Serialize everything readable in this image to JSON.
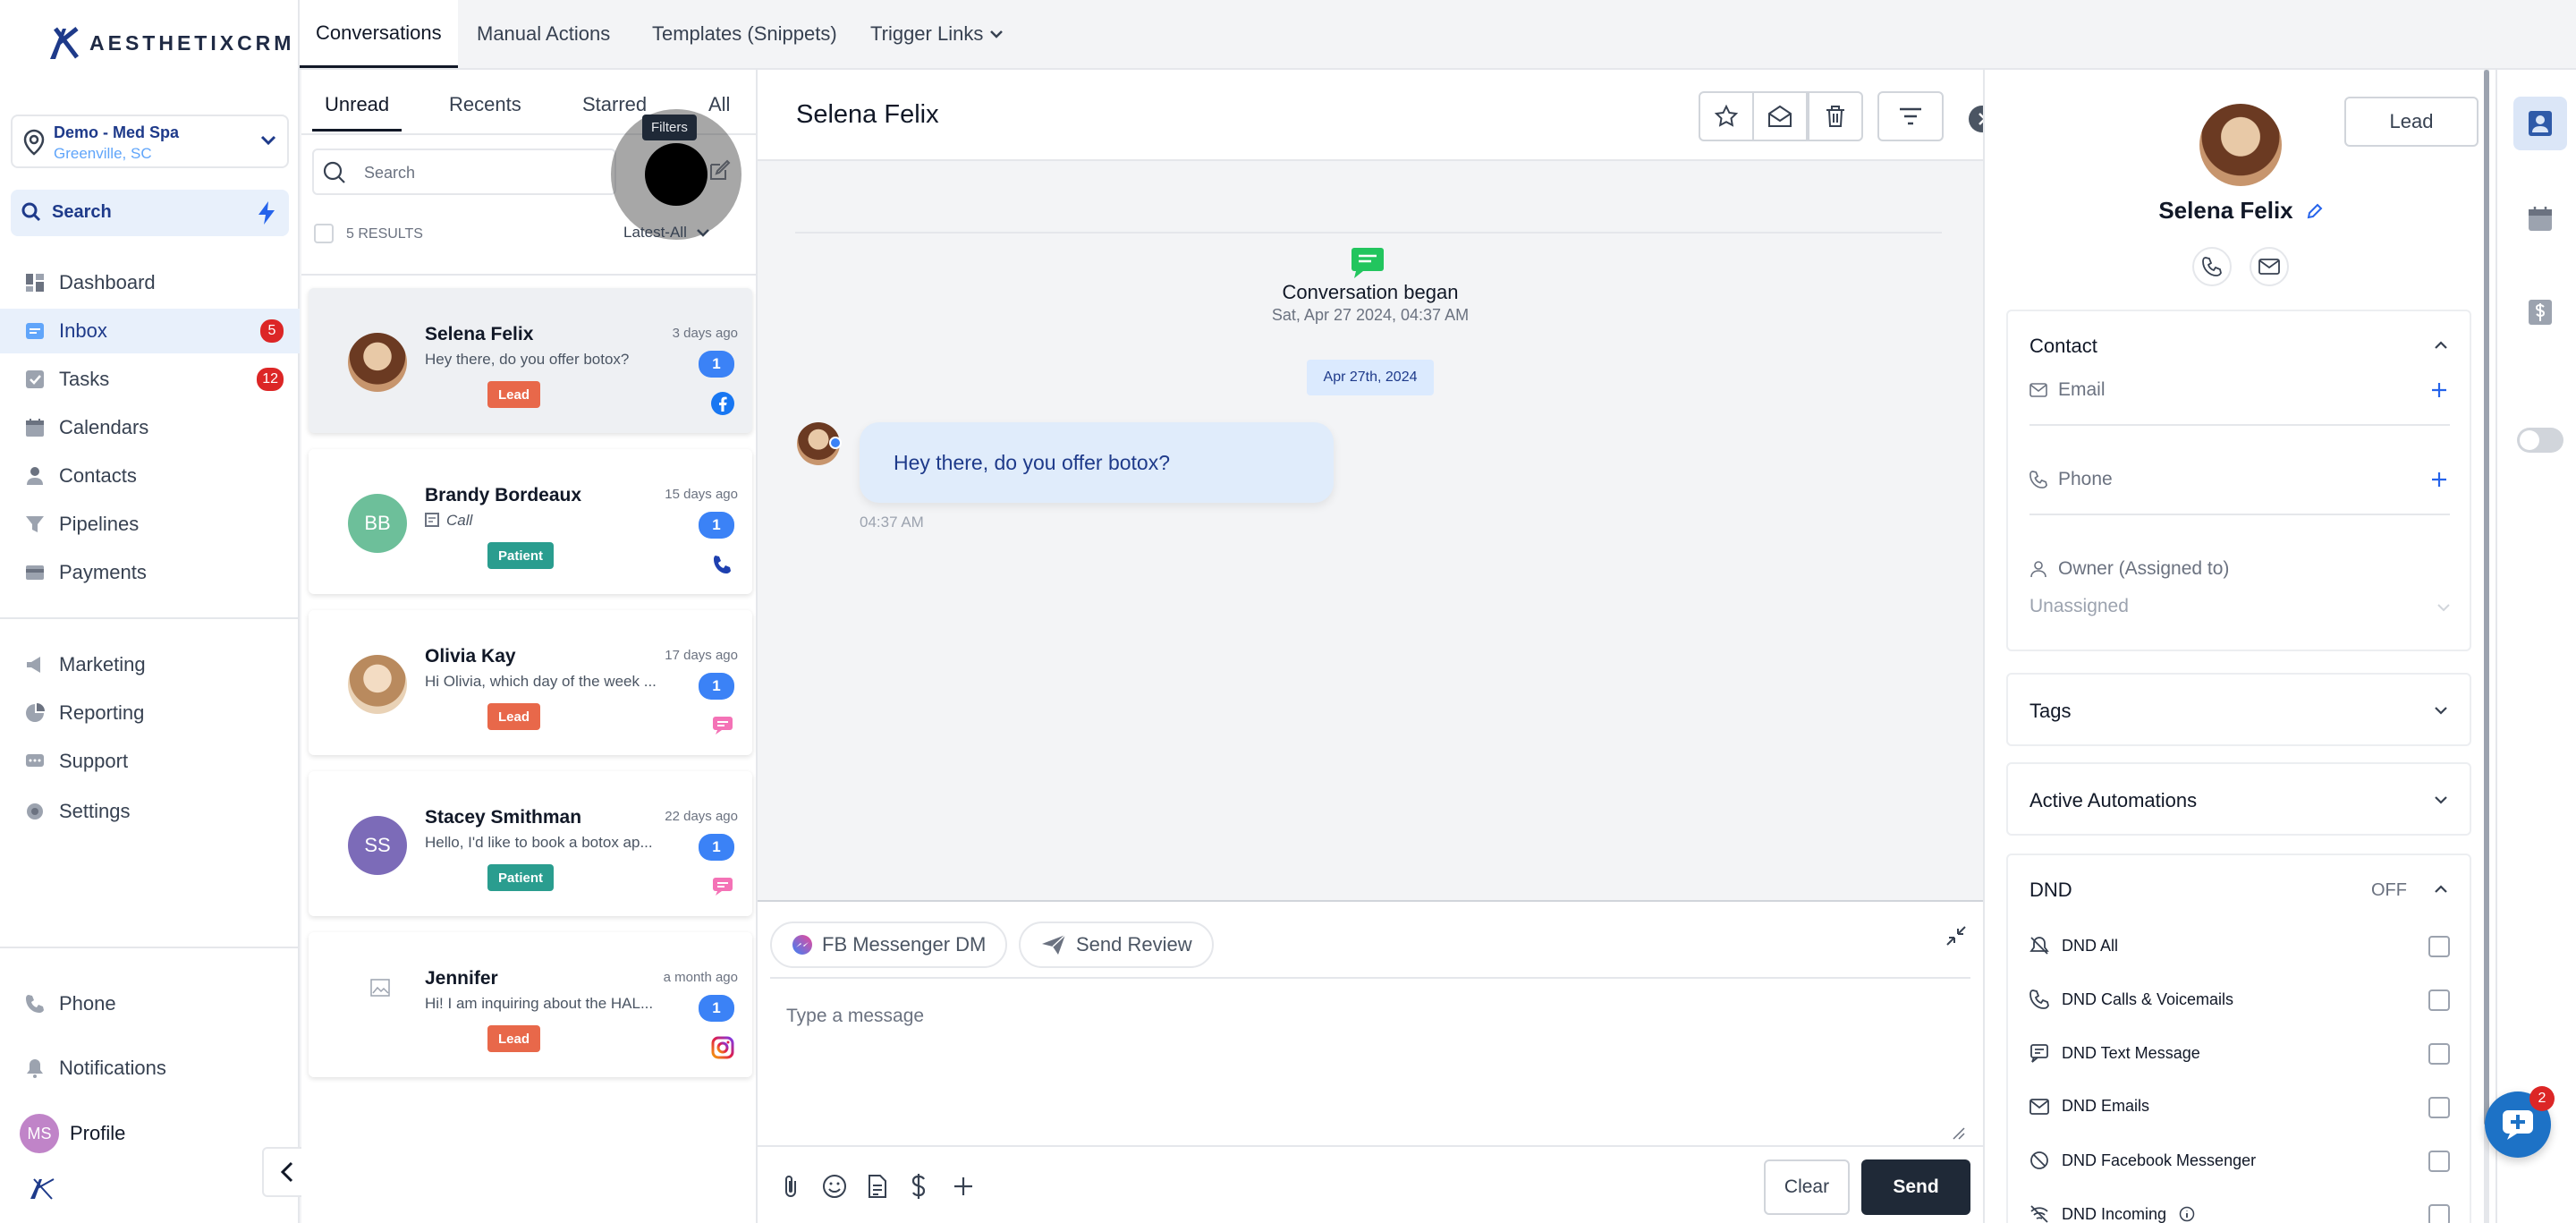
{
  "brand": {
    "name": "AESTHETIXCRM",
    "accent": "#1e3a8a"
  },
  "location": {
    "name": "Demo - Med Spa",
    "city": "Greenville, SC"
  },
  "sidebar_search": {
    "label": "Search"
  },
  "nav": [
    {
      "label": "Dashboard",
      "icon": "dashboard-icon"
    },
    {
      "label": "Inbox",
      "icon": "inbox-icon",
      "badge": "5"
    },
    {
      "label": "Tasks",
      "icon": "tasks-icon",
      "badge": "12"
    },
    {
      "label": "Calendars",
      "icon": "calendar-icon"
    },
    {
      "label": "Contacts",
      "icon": "contacts-icon"
    },
    {
      "label": "Pipelines",
      "icon": "pipelines-icon"
    },
    {
      "label": "Payments",
      "icon": "payments-icon"
    }
  ],
  "nav2": [
    {
      "label": "Marketing",
      "icon": "megaphone-icon"
    },
    {
      "label": "Reporting",
      "icon": "chart-icon"
    },
    {
      "label": "Support",
      "icon": "chat-icon"
    },
    {
      "label": "Settings",
      "icon": "gear-icon"
    }
  ],
  "bottom_nav": {
    "phone": "Phone",
    "notifications": "Notifications",
    "profile": "Profile",
    "profile_initials": "MS"
  },
  "top_tabs": [
    "Conversations",
    "Manual Actions",
    "Templates (Snippets)",
    "Trigger Links"
  ],
  "filter_tabs": [
    "Unread",
    "Recents",
    "Starred",
    "All"
  ],
  "list_search": {
    "placeholder": "Search"
  },
  "tooltip": "Filters",
  "results": {
    "count": "5 RESULTS",
    "sort": "Latest-All"
  },
  "conversations": [
    {
      "name": "Selena Felix",
      "time": "3 days ago",
      "message": "Hey there, do you offer botox?",
      "count": "1",
      "tag": "Lead",
      "channel": "facebook-icon",
      "initials": ""
    },
    {
      "name": "Brandy Bordeaux",
      "time": "15 days ago",
      "message": "Call",
      "count": "1",
      "tag": "Patient",
      "channel": "phone-call-icon",
      "initials": "BB"
    },
    {
      "name": "Olivia Kay",
      "time": "17 days ago",
      "message": "Hi Olivia, which day of the week ...",
      "count": "1",
      "tag": "Lead",
      "channel": "sms-icon",
      "initials": ""
    },
    {
      "name": "Stacey Smithman",
      "time": "22 days ago",
      "message": "Hello, I'd like to book a botox ap...",
      "count": "1",
      "tag": "Patient",
      "channel": "sms-icon",
      "initials": "SS"
    },
    {
      "name": "Jennifer",
      "time": "a month ago",
      "message": "Hi! I am inquiring about the HAL...",
      "count": "1",
      "tag": "Lead",
      "channel": "instagram-icon",
      "initials": ""
    }
  ],
  "chat": {
    "contact_name": "Selena Felix",
    "began_label": "Conversation began",
    "began_date": "Sat, Apr 27 2024, 04:37 AM",
    "date_chip": "Apr 27th, 2024",
    "message": "Hey there, do you offer botox?",
    "message_time": "04:37 AM"
  },
  "composer": {
    "channel": "FB Messenger DM",
    "review": "Send Review",
    "placeholder": "Type a message",
    "clear": "Clear",
    "send": "Send"
  },
  "contact": {
    "name": "Selena Felix",
    "status_button": "Lead",
    "section_contact": "Contact",
    "email_label": "Email",
    "phone_label": "Phone",
    "owner_label": "Owner (Assigned to)",
    "owner_value": "Unassigned",
    "tags": "Tags",
    "automations": "Active Automations",
    "dnd": "DND",
    "dnd_state": "OFF",
    "dnd_items": [
      "DND All",
      "DND Calls & Voicemails",
      "DND Text Message",
      "DND Emails",
      "DND Facebook Messenger",
      "DND Incoming"
    ]
  },
  "chat_widget": {
    "badge": "2"
  },
  "colors": {
    "lead": "#e8684a",
    "patient": "#2a9d8f",
    "count": "#3b82f6",
    "send": "#1f2937"
  }
}
